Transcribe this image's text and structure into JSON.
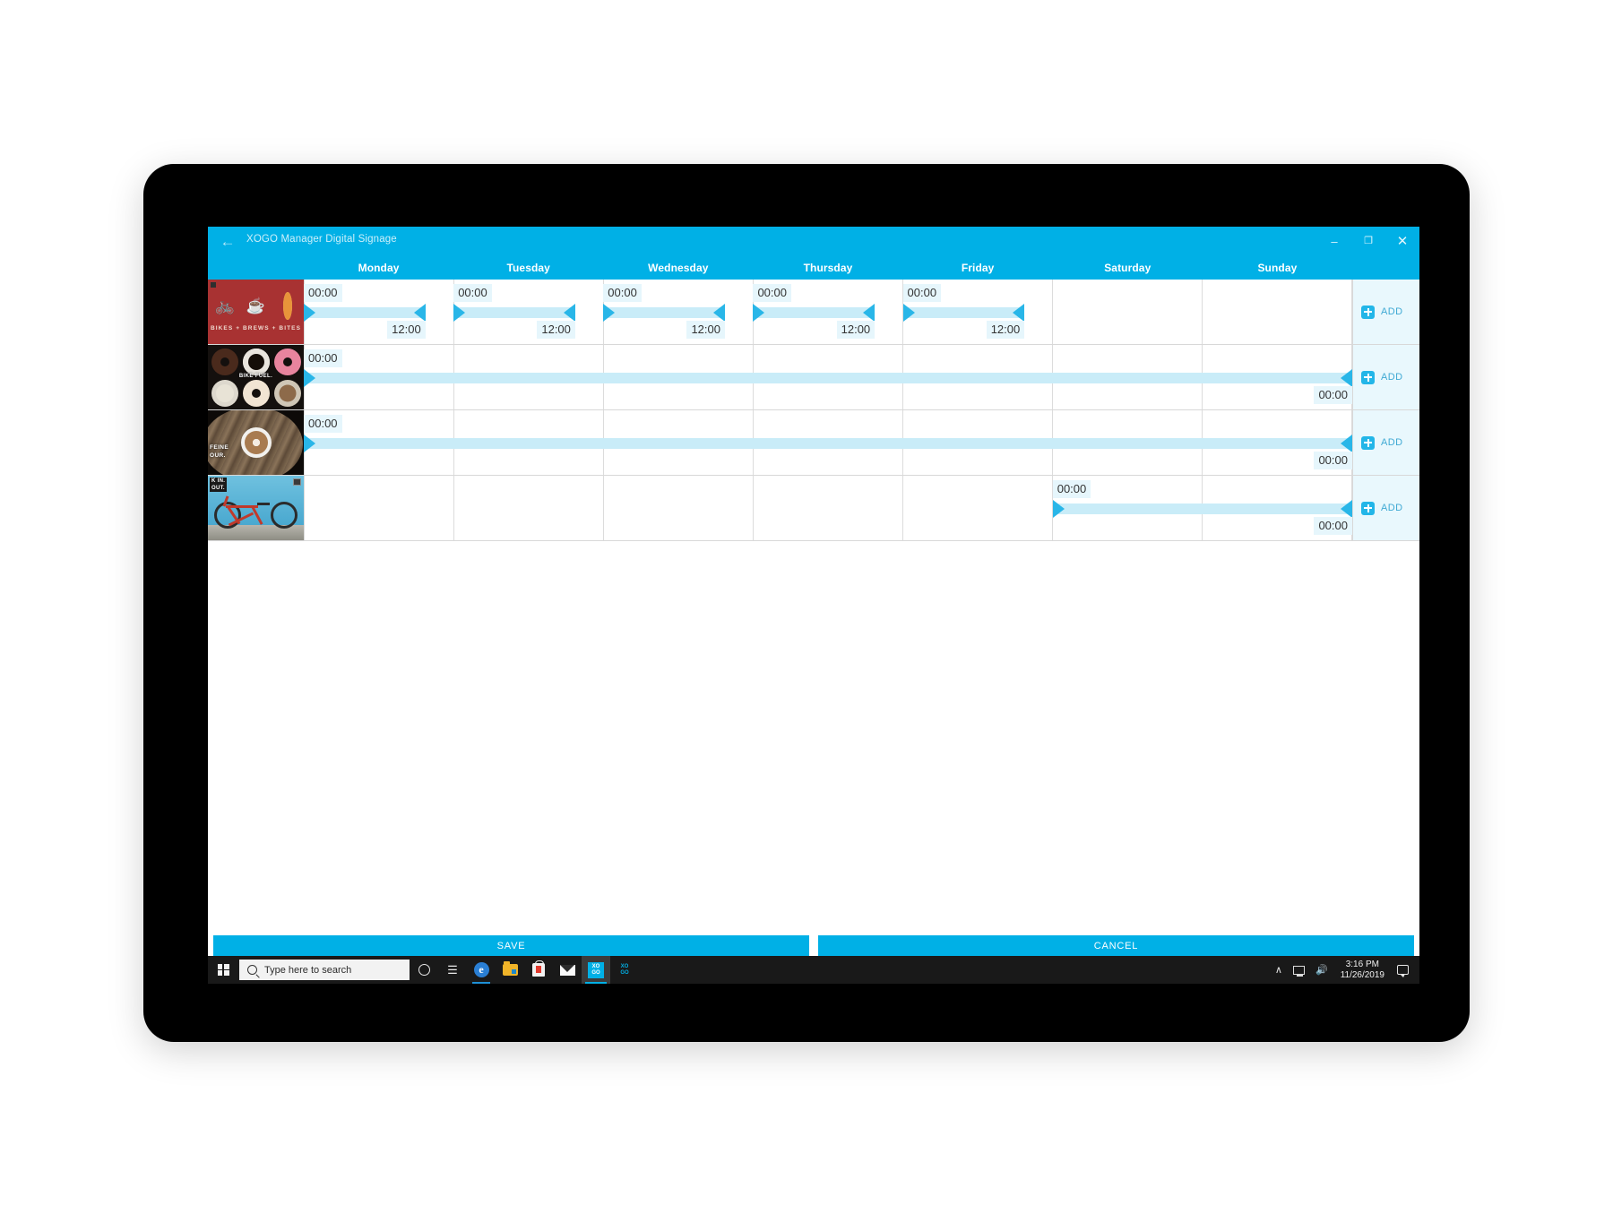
{
  "window": {
    "title": "XOGO Manager Digital Signage",
    "back_icon": "back-arrow-icon",
    "minimize": "–",
    "maximize": "❐",
    "close": "✕"
  },
  "schedule": {
    "days": [
      "Monday",
      "Tuesday",
      "Wednesday",
      "Thursday",
      "Friday",
      "Saturday",
      "Sunday"
    ],
    "add_label": "ADD",
    "rows": [
      {
        "thumbnail_name": "bikes-brews-bites-red-poster",
        "thumbnail_caption": "BIKES + BREWS + BITES",
        "segments": [
          {
            "day": "Monday",
            "start": "00:00",
            "end": "12:00"
          },
          {
            "day": "Tuesday",
            "start": "00:00",
            "end": "12:00"
          },
          {
            "day": "Wednesday",
            "start": "00:00",
            "end": "12:00"
          },
          {
            "day": "Thursday",
            "start": "00:00",
            "end": "12:00"
          },
          {
            "day": "Friday",
            "start": "00:00",
            "end": "12:00"
          }
        ]
      },
      {
        "thumbnail_name": "bike-fuel-donuts-coffee-photo",
        "thumbnail_caption": "BIKE FUEL.",
        "segments": [
          {
            "day": "Monday-Sunday",
            "start": "00:00",
            "end": "00:00",
            "span_start": 0,
            "span_end": 7
          }
        ]
      },
      {
        "thumbnail_name": "caffeine-hour-latte-photo",
        "thumbnail_caption_line1": "FEINE",
        "thumbnail_caption_line2": "OUR.",
        "segments": [
          {
            "day": "Monday-Sunday",
            "start": "00:00",
            "end": "00:00",
            "span_start": 0,
            "span_end": 7
          }
        ]
      },
      {
        "thumbnail_name": "red-bicycle-blue-wall-photo",
        "thumbnail_caption_line1": "K IN.",
        "thumbnail_caption_line2": "OUT.",
        "segments": [
          {
            "day": "Saturday-Sunday",
            "start": "00:00",
            "end": "00:00",
            "span_start": 5,
            "span_end": 7
          }
        ]
      }
    ]
  },
  "footer": {
    "save_label": "SAVE",
    "cancel_label": "CANCEL"
  },
  "taskbar": {
    "start_icon": "windows-logo-icon",
    "search_placeholder": "Type here to search",
    "search_icon": "search-icon",
    "items": [
      {
        "name": "cortana-icon",
        "label": ""
      },
      {
        "name": "task-view-icon",
        "label": "☰"
      },
      {
        "name": "edge-browser-icon",
        "label": "e"
      },
      {
        "name": "file-explorer-icon",
        "label": ""
      },
      {
        "name": "microsoft-store-icon",
        "label": ""
      },
      {
        "name": "mail-icon",
        "label": ""
      },
      {
        "name": "xogo-manager-icon",
        "label": "XO GO"
      },
      {
        "name": "xogo-player-icon",
        "label": "XO GO"
      }
    ],
    "tray": {
      "chevron": "∧",
      "network_icon": "network-icon",
      "volume_icon": "🔊",
      "time": "3:16 PM",
      "date": "11/26/2019",
      "action_center_icon": "action-center-icon"
    }
  },
  "colors": {
    "accent": "#00b0e6",
    "slider_track": "#c9ecf8",
    "slider_handle": "#29b6e8",
    "add_cell_bg": "#e9f8fd",
    "label_bg": "#e6f6fc"
  }
}
